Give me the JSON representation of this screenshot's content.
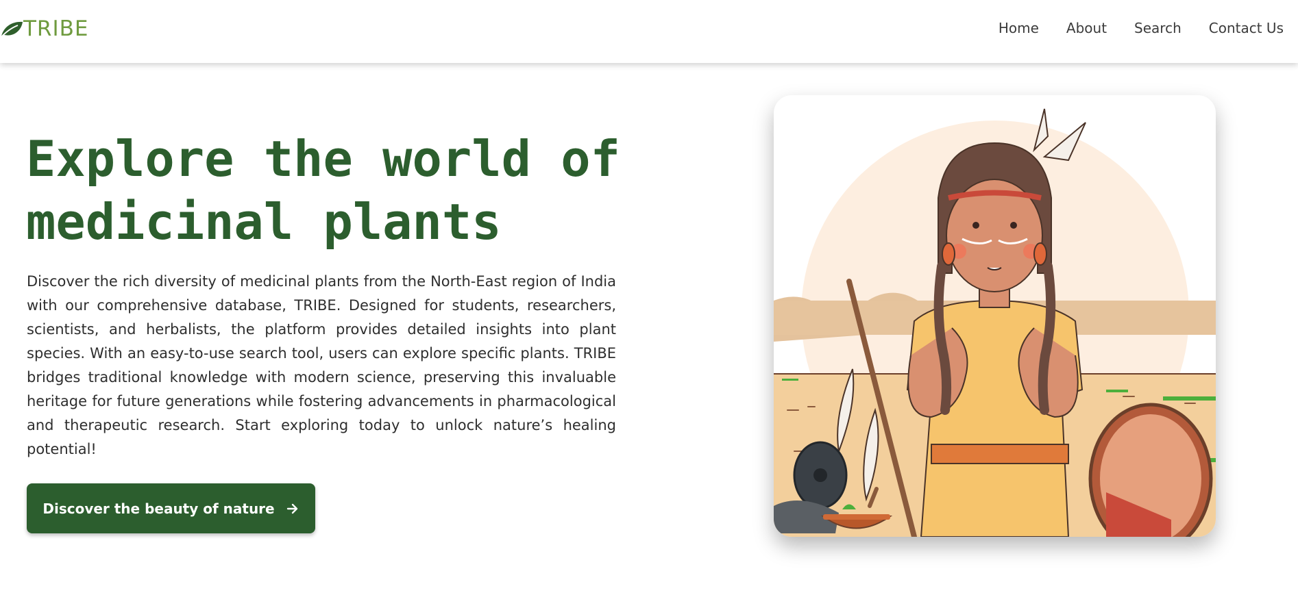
{
  "header": {
    "logo_text": "TRIBE",
    "logo_icon": "leaf-icon",
    "nav": [
      {
        "label": "Home"
      },
      {
        "label": "About"
      },
      {
        "label": "Search"
      },
      {
        "label": "Contact Us"
      }
    ]
  },
  "hero": {
    "title_line1": "Explore the world of",
    "title_line2": "medicinal plants",
    "description": "Discover the rich diversity of medicinal plants from the North-East region of India with our comprehensive database, TRIBE. Designed for students, researchers, scientists, and herbalists, the platform provides detailed insights into plant species. With an easy-to-use search tool, users can explore specific plants. TRIBE bridges traditional knowledge with modern science, preserving this invaluable heritage for future generations while fostering advancements in pharmacological and therapeutic research. Start exploring today to unlock nature’s healing potential!",
    "cta_label": "Discover the beauty of nature",
    "cta_icon": "arrow-right-icon"
  },
  "colors": {
    "brand_green": "#2c5e2e",
    "logo_green": "#6f9b3f",
    "sun": "#fdeee0",
    "desert": "#f3cf9c"
  }
}
